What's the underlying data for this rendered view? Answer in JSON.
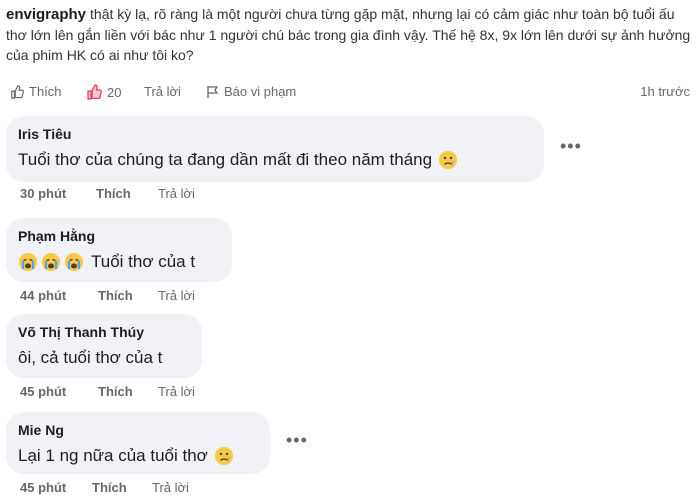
{
  "post": {
    "author": "envigraphy",
    "text": "thật kỳ lạ, rõ ràng là một người chưa từng gặp mặt, nhưng lại có cảm giác như toàn bộ tuổi ấu thơ lớn lên gắn liền với bác như 1 người chú bác trong gia đình vậy. Thế hệ 8x, 9x lớn lên dưới sự ảnh hưởng của phim HK có ai như tôi ko?",
    "like_label": "Thích",
    "reaction_count": "20",
    "reply_label": "Trả lời",
    "report_label": "Báo vi phạm",
    "time": "1h trước"
  },
  "comments": [
    {
      "name": "Iris Tiêu",
      "text": "Tuổi thơ của chúng ta đang dần mất đi theo năm tháng",
      "emoji": "sad-face-icon",
      "time": "30 phút",
      "like_label": "Thích",
      "reply_label": "Trả lời"
    },
    {
      "name": "Phạm Hằng",
      "text": "Tuổi thơ của t",
      "emoji": "crying-face-icon",
      "time": "44 phút",
      "like_label": "Thích",
      "reply_label": "Trả lời"
    },
    {
      "name": "Võ Thị Thanh Thúy",
      "text": "ôi, cả tuổi thơ của t",
      "time": "45 phút",
      "like_label": "Thích",
      "reply_label": "Trả lời"
    },
    {
      "name": "Mie Ng",
      "text": "Lại 1 ng nữa của tuổi thơ",
      "emoji": "sad-face-icon",
      "time": "45 phút",
      "like_label": "Thích",
      "reply_label": "Trả lời"
    }
  ],
  "colors": {
    "bubble": "#f0f2f5",
    "meta": "#65676b",
    "react_accent": "#e4405f"
  }
}
